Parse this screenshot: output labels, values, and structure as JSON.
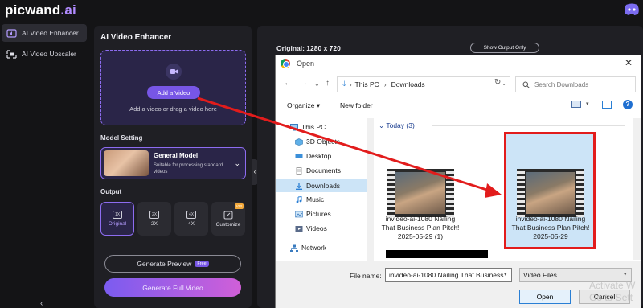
{
  "app": {
    "logo_main": "picwand",
    "logo_suffix": ".ai"
  },
  "nav": {
    "items": [
      {
        "label": "AI Video Enhancer",
        "icon": "video-enhance-icon",
        "active": true
      },
      {
        "label": "AI Video Upscaler",
        "icon": "video-upscale-icon",
        "active": false
      }
    ]
  },
  "panel": {
    "title": "AI Video Enhancer",
    "upload": {
      "button_label": "Add a Video",
      "hint": "Add a video or drag a video here"
    },
    "model_setting_label": "Model Setting",
    "model": {
      "name": "General Model",
      "description": "Suitable for processing standard videos"
    },
    "output_label": "Output",
    "output_options": [
      {
        "icon_text": "1X",
        "label": "Original",
        "selected": true,
        "vip": ""
      },
      {
        "icon_text": "2X",
        "label": "2X",
        "selected": false,
        "vip": ""
      },
      {
        "icon_text": "4X",
        "label": "4X",
        "selected": false,
        "vip": ""
      },
      {
        "icon_text": "",
        "label": "Customize",
        "selected": false,
        "vip": "VIP"
      }
    ],
    "generate_preview_label": "Generate Preview",
    "free_badge": "Free",
    "generate_full_label": "Generate Full Video"
  },
  "preview": {
    "original_label": "Original: 1280 x 720",
    "show_output_label": "Show Output Only"
  },
  "dialog": {
    "title": "Open",
    "breadcrumb": [
      "This PC",
      "Downloads"
    ],
    "search_placeholder": "Search Downloads",
    "organize_label": "Organize",
    "new_folder_label": "New folder",
    "sidebar": [
      {
        "label": "This PC",
        "icon": "computer-icon",
        "selected": false
      },
      {
        "label": "3D Objects",
        "icon": "cube-icon",
        "selected": false
      },
      {
        "label": "Desktop",
        "icon": "desktop-icon",
        "selected": false
      },
      {
        "label": "Documents",
        "icon": "documents-icon",
        "selected": false
      },
      {
        "label": "Downloads",
        "icon": "download-arrow-icon",
        "selected": true
      },
      {
        "label": "Music",
        "icon": "music-note-icon",
        "selected": false
      },
      {
        "label": "Pictures",
        "icon": "pictures-icon",
        "selected": false
      },
      {
        "label": "Videos",
        "icon": "videos-icon",
        "selected": false
      },
      {
        "label": "Network",
        "icon": "network-icon",
        "selected": false
      }
    ],
    "group_header": "Today (3)",
    "files": [
      {
        "name": "invideo-ai-1080 Nailing That Business Plan Pitch! 2025-05-29 (1)",
        "selected": false
      },
      {
        "name": "invideo-ai-1080 Nailing That Business Plan Pitch! 2025-05-29",
        "selected": true
      }
    ],
    "file_name_label": "File name:",
    "file_name_value": "invideo-ai-1080 Nailing That Business",
    "file_type_value": "Video Files",
    "open_label": "Open",
    "cancel_label": "Cancel"
  },
  "watermark": {
    "line1": "Activate W",
    "line2": "Go to Sett"
  },
  "colors": {
    "accent": "#7756e6",
    "annotation": "#e21c1c",
    "background": "#141416"
  }
}
